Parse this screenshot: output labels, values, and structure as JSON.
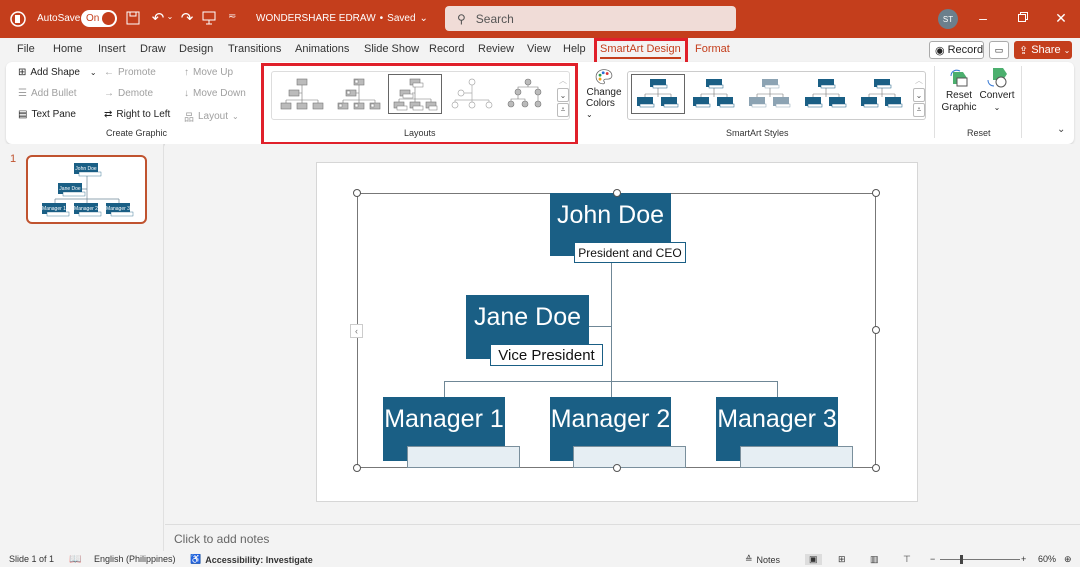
{
  "titlebar": {
    "autosave_label": "AutoSave",
    "autosave_state": "On",
    "doc_title": "WONDERSHARE EDRAW",
    "doc_status": "Saved",
    "search_placeholder": "Search",
    "user_initials": "ST"
  },
  "menu": {
    "tabs": [
      "File",
      "Home",
      "Insert",
      "Draw",
      "Design",
      "Transitions",
      "Animations",
      "Slide Show",
      "Record",
      "Review",
      "View",
      "Help",
      "SmartArt Design",
      "Format"
    ],
    "active_tab": "SmartArt Design",
    "record_label": "Record",
    "share_label": "Share"
  },
  "ribbon": {
    "create_graphic": {
      "add_shape": "Add Shape",
      "add_bullet": "Add Bullet",
      "text_pane": "Text Pane",
      "promote": "Promote",
      "demote": "Demote",
      "right_to_left": "Right to Left",
      "move_up": "Move Up",
      "move_down": "Move Down",
      "layout": "Layout",
      "group_label": "Create Graphic"
    },
    "layouts": {
      "group_label": "Layouts",
      "items": [
        "Organization Chart",
        "Name and Title Organization Chart",
        "Half Circle Organization Chart",
        "Circle Picture Hierarchy",
        "Hierarchy"
      ],
      "selected_index": 2
    },
    "change_colors": {
      "line1": "Change",
      "line2": "Colors"
    },
    "styles": {
      "group_label": "SmartArt Styles",
      "items": [
        "Simple Fill",
        "White Outline",
        "Subtle Effect",
        "Moderate Effect",
        "Intense Effect"
      ],
      "selected_index": 0
    },
    "reset": {
      "reset_graphic_1": "Reset",
      "reset_graphic_2": "Graphic",
      "convert": "Convert",
      "group_label": "Reset"
    },
    "accent_color": "#1a5f85"
  },
  "thumbnails": [
    {
      "number": "1"
    }
  ],
  "slide": {
    "nodes": [
      {
        "name": "John Doe",
        "title": "President and CEO"
      },
      {
        "name": "Jane Doe",
        "title": "Vice President"
      },
      {
        "name": "Manager 1",
        "title": ""
      },
      {
        "name": "Manager 2",
        "title": ""
      },
      {
        "name": "Manager 3",
        "title": ""
      }
    ]
  },
  "notes_placeholder": "Click to add notes",
  "statusbar": {
    "slide_info": "Slide 1 of 1",
    "language": "English (Philippines)",
    "accessibility": "Accessibility: Investigate",
    "notes_label": "Notes",
    "zoom": "60%"
  }
}
